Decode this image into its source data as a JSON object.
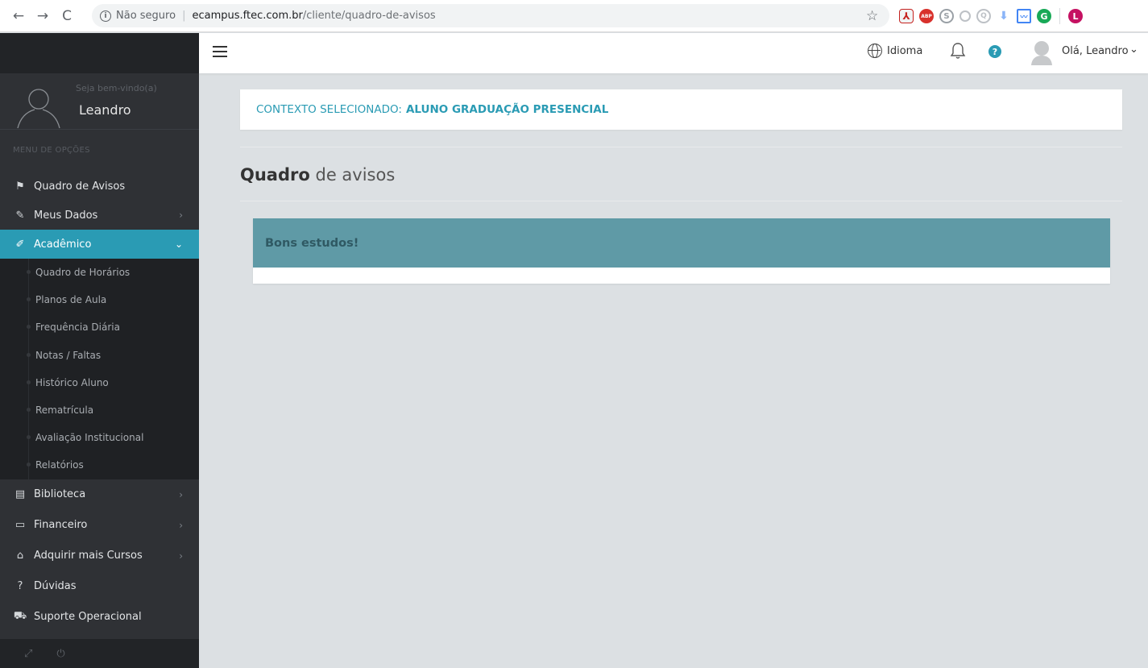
{
  "browser": {
    "back": "←",
    "forward": "→",
    "reload": "C",
    "info": "i",
    "insecure_label": "Não seguro",
    "separator": "|",
    "url_domain": "ecampus.ftec.com.br",
    "url_path": "/cliente/quadro-de-avisos",
    "star": "☆",
    "extensions": {
      "pdf": "⅄",
      "abp": "ABP",
      "s": "S",
      "q": "Q",
      "download": "⬇",
      "chart": "〰",
      "grammarly": "G",
      "profile": "L"
    }
  },
  "sidebar": {
    "welcome": "Seja bem-vindo(a)",
    "username": "Leandro",
    "menu_title": "MENU DE OPÇÕES",
    "items": [
      {
        "label": "Quadro de Avisos",
        "icon": "flag-icon",
        "glyph": "⚑"
      },
      {
        "label": "Meus Dados",
        "icon": "edit-icon",
        "glyph": "✎",
        "chevron": "›"
      },
      {
        "label": "Acadêmico",
        "icon": "pencil-icon",
        "glyph": "✐",
        "chevron": "⌄"
      }
    ],
    "academic_sub": [
      "Quadro de Horários",
      "Planos de Aula",
      "Frequência Diária",
      "Notas / Faltas",
      "Histórico Aluno",
      "Rematrícula",
      "Avaliação Institucional",
      "Relatórios"
    ],
    "lower_items": [
      {
        "label": "Biblioteca",
        "icon": "book-icon",
        "glyph": "▤",
        "chevron": "›"
      },
      {
        "label": "Financeiro",
        "icon": "folder-icon",
        "glyph": "▭",
        "chevron": "›"
      },
      {
        "label": "Adquirir mais Cursos",
        "icon": "home-icon",
        "glyph": "⌂",
        "chevron": "›"
      },
      {
        "label": "Dúvidas",
        "icon": "question-icon",
        "glyph": "?",
        "chevron": ""
      },
      {
        "label": "Suporte Operacional",
        "icon": "support-icon",
        "glyph": "⛟",
        "chevron": ""
      }
    ],
    "footer": {
      "expand": "⤢",
      "power": "⏻"
    }
  },
  "header": {
    "language_label": "Idioma",
    "bell": "🔔",
    "help": "?",
    "greeting": "Olá, Leandro",
    "greeting_chevron": "⌄"
  },
  "main": {
    "context_prefix": "CONTEXTO SELECIONADO:",
    "context_value": "ALUNO GRADUAÇÃO PRESENCIAL",
    "heading_bold": "Quadro",
    "heading_light": "de avisos",
    "notice_title": "Bons estudos!"
  },
  "colors": {
    "accent": "#2a9bb4",
    "sidebar_bg": "#2f3135",
    "notice_header": "#5f9aa6",
    "page_bg": "#dce0e3"
  }
}
